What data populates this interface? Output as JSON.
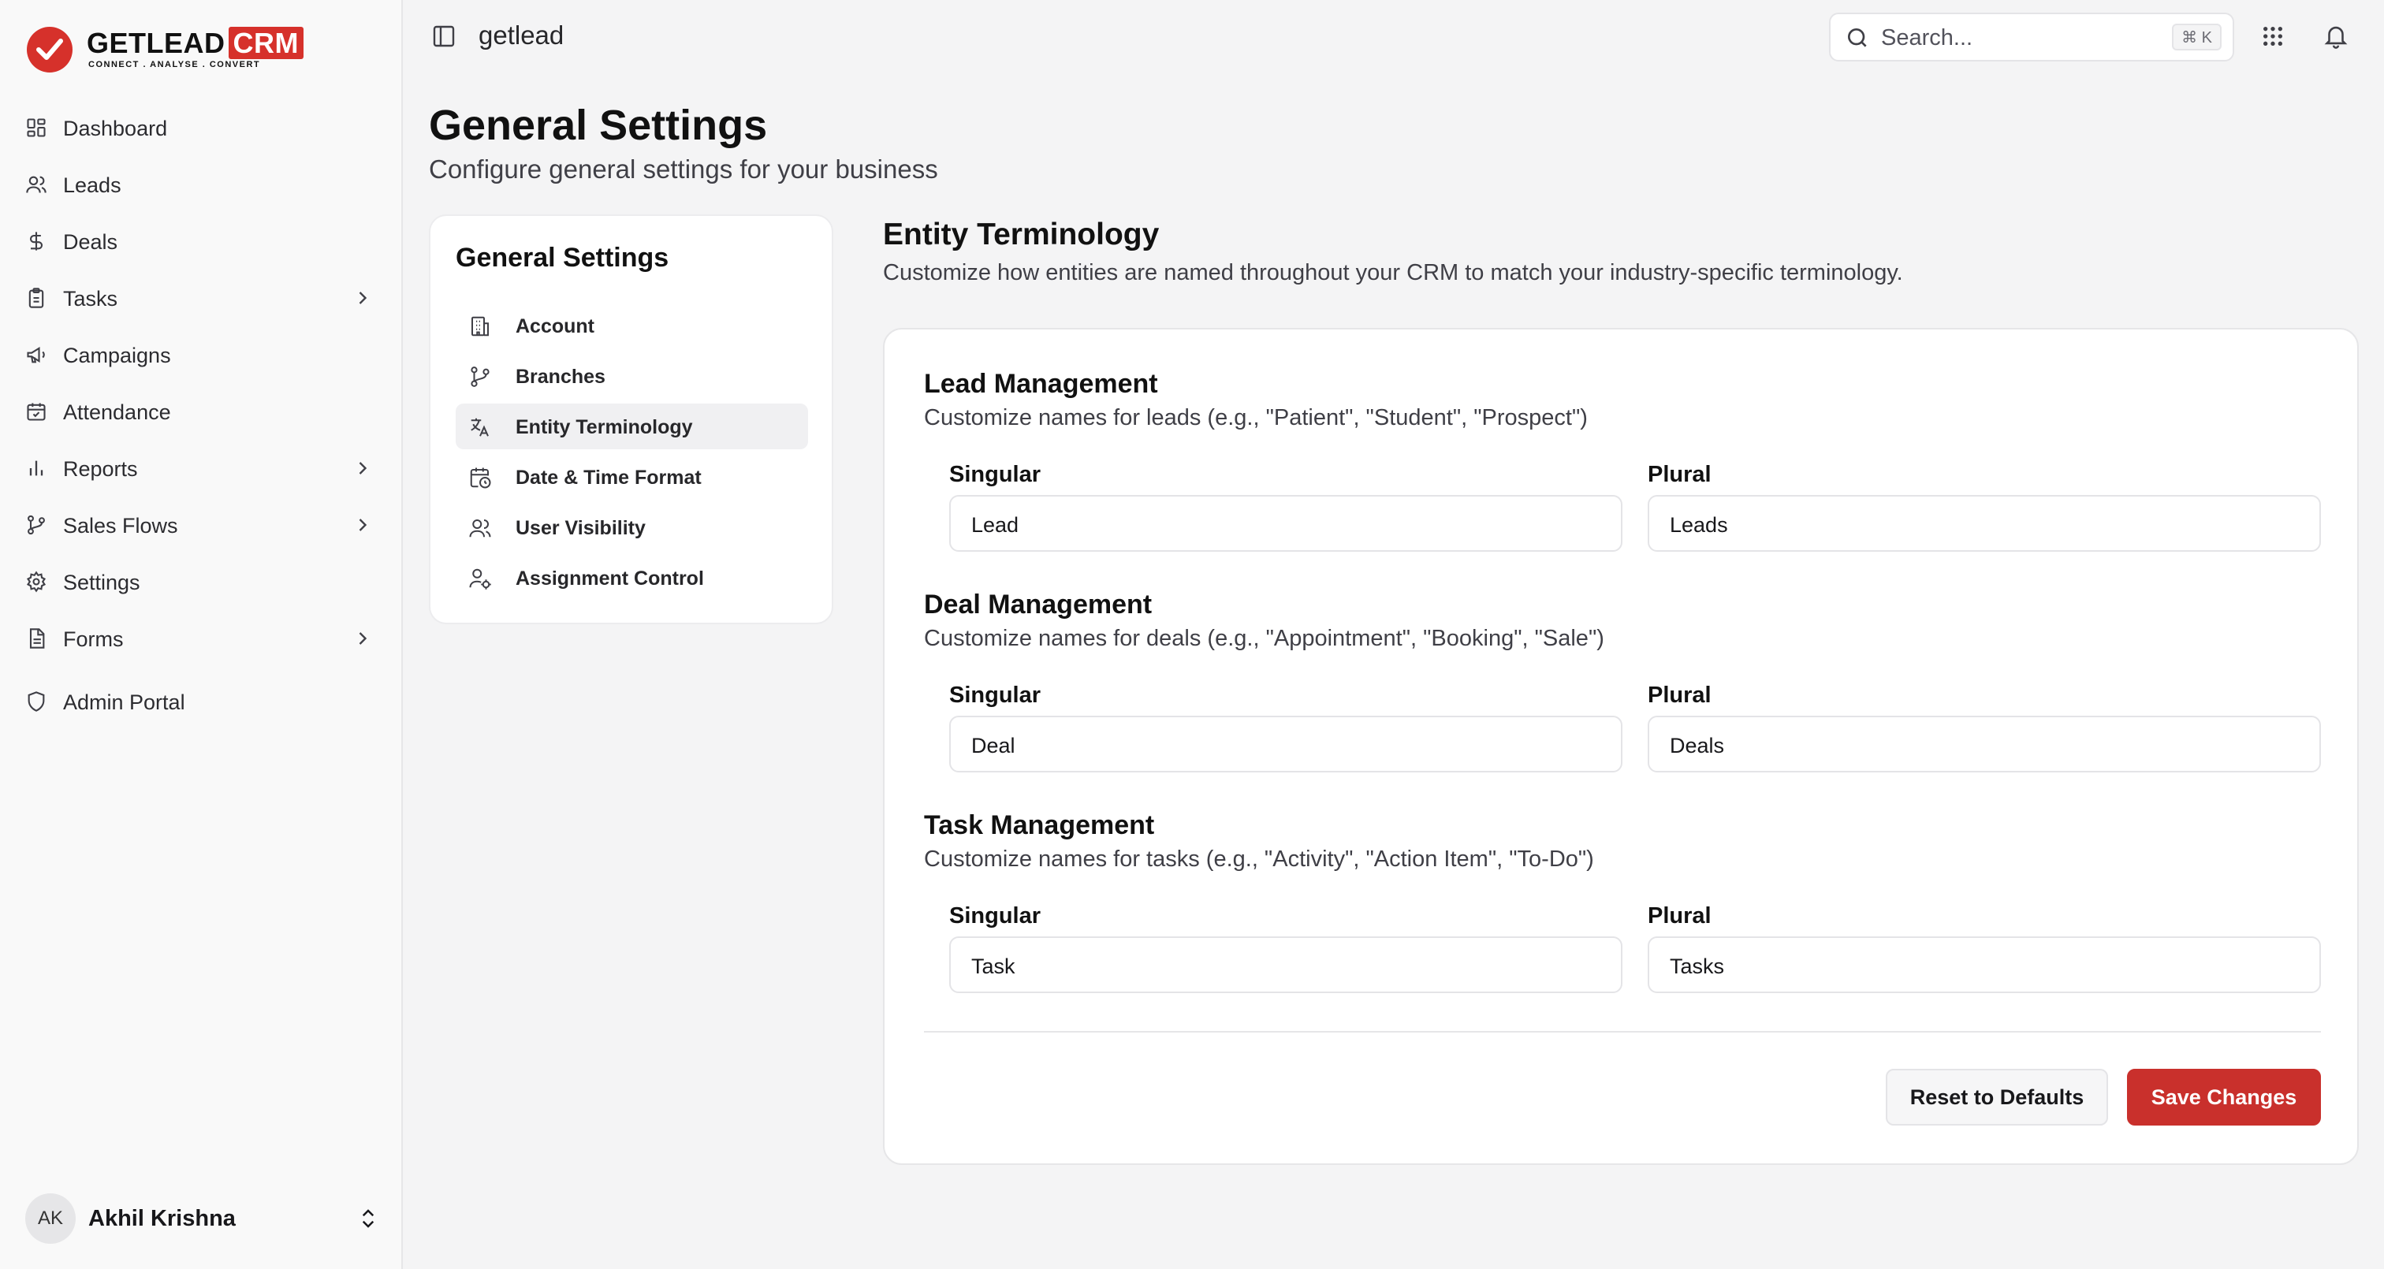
{
  "brand": {
    "name": "GETLEAD",
    "crm": "CRM",
    "tagline": "CONNECT  .  ANALYSE  .  CONVERT",
    "accent": "#d6312b"
  },
  "sidebar": {
    "items": [
      {
        "label": "Dashboard",
        "icon": "grid-icon",
        "chevron": false
      },
      {
        "label": "Leads",
        "icon": "users-icon",
        "chevron": false
      },
      {
        "label": "Deals",
        "icon": "dollar-icon",
        "chevron": false
      },
      {
        "label": "Tasks",
        "icon": "clipboard-icon",
        "chevron": true
      },
      {
        "label": "Campaigns",
        "icon": "megaphone-icon",
        "chevron": false
      },
      {
        "label": "Attendance",
        "icon": "calendar-check-icon",
        "chevron": false
      },
      {
        "label": "Reports",
        "icon": "bar-chart-icon",
        "chevron": true
      },
      {
        "label": "Sales Flows",
        "icon": "git-branch-icon",
        "chevron": true
      },
      {
        "label": "Settings",
        "icon": "gear-icon",
        "chevron": false
      },
      {
        "label": "Forms",
        "icon": "file-icon",
        "chevron": true
      },
      {
        "label": "Admin Portal",
        "icon": "shield-icon",
        "chevron": false
      }
    ],
    "user": {
      "initials": "AK",
      "name": "Akhil Krishna"
    }
  },
  "topbar": {
    "breadcrumb": "getlead",
    "search": {
      "placeholder": "Search...",
      "shortcut": "⌘ K"
    }
  },
  "page": {
    "title": "General Settings",
    "subtitle": "Configure general settings for your business"
  },
  "settings_nav": {
    "title": "General Settings",
    "items": [
      {
        "label": "Account",
        "icon": "building-icon",
        "active": false
      },
      {
        "label": "Branches",
        "icon": "git-branch-icon",
        "active": false
      },
      {
        "label": "Entity Terminology",
        "icon": "translate-icon",
        "active": true
      },
      {
        "label": "Date & Time Format",
        "icon": "calendar-clock-icon",
        "active": false
      },
      {
        "label": "User Visibility",
        "icon": "users-icon",
        "active": false
      },
      {
        "label": "Assignment Control",
        "icon": "user-cog-icon",
        "active": false
      }
    ]
  },
  "content": {
    "title": "Entity Terminology",
    "subtitle": "Customize how entities are named throughout your CRM to match your industry-specific terminology.",
    "groups": [
      {
        "title": "Lead Management",
        "subtitle": "Customize names for leads (e.g., \"Patient\", \"Student\", \"Prospect\")",
        "singular_label": "Singular",
        "singular_value": "Lead",
        "plural_label": "Plural",
        "plural_value": "Leads"
      },
      {
        "title": "Deal Management",
        "subtitle": "Customize names for deals (e.g., \"Appointment\", \"Booking\", \"Sale\")",
        "singular_label": "Singular",
        "singular_value": "Deal",
        "plural_label": "Plural",
        "plural_value": "Deals"
      },
      {
        "title": "Task Management",
        "subtitle": "Customize names for tasks (e.g., \"Activity\", \"Action Item\", \"To-Do\")",
        "singular_label": "Singular",
        "singular_value": "Task",
        "plural_label": "Plural",
        "plural_value": "Tasks"
      }
    ],
    "reset_label": "Reset to Defaults",
    "save_label": "Save Changes"
  }
}
